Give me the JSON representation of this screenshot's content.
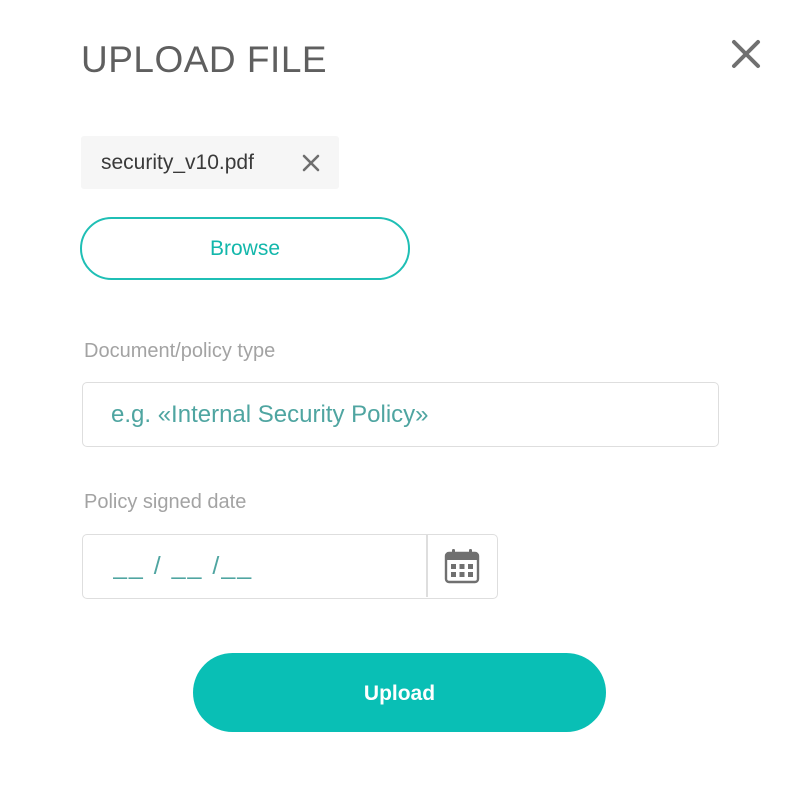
{
  "dialog": {
    "title": "UPLOAD FILE",
    "close_icon": "close-icon"
  },
  "file": {
    "name": "security_v10.pdf",
    "remove_icon": "close-icon"
  },
  "browse": {
    "label": "Browse"
  },
  "document_type": {
    "label": "Document/policy type",
    "placeholder": "e.g. «Internal Security Policy»",
    "value": ""
  },
  "signed_date": {
    "label": "Policy signed date",
    "placeholder": "__ / __ /__",
    "value": "",
    "calendar_icon": "calendar-icon"
  },
  "upload": {
    "label": "Upload"
  },
  "colors": {
    "accent": "#09bfb5",
    "title": "#5f5f5f",
    "label": "#a3a3a3",
    "placeholder": "#4fa5a1",
    "border": "#dedede"
  }
}
